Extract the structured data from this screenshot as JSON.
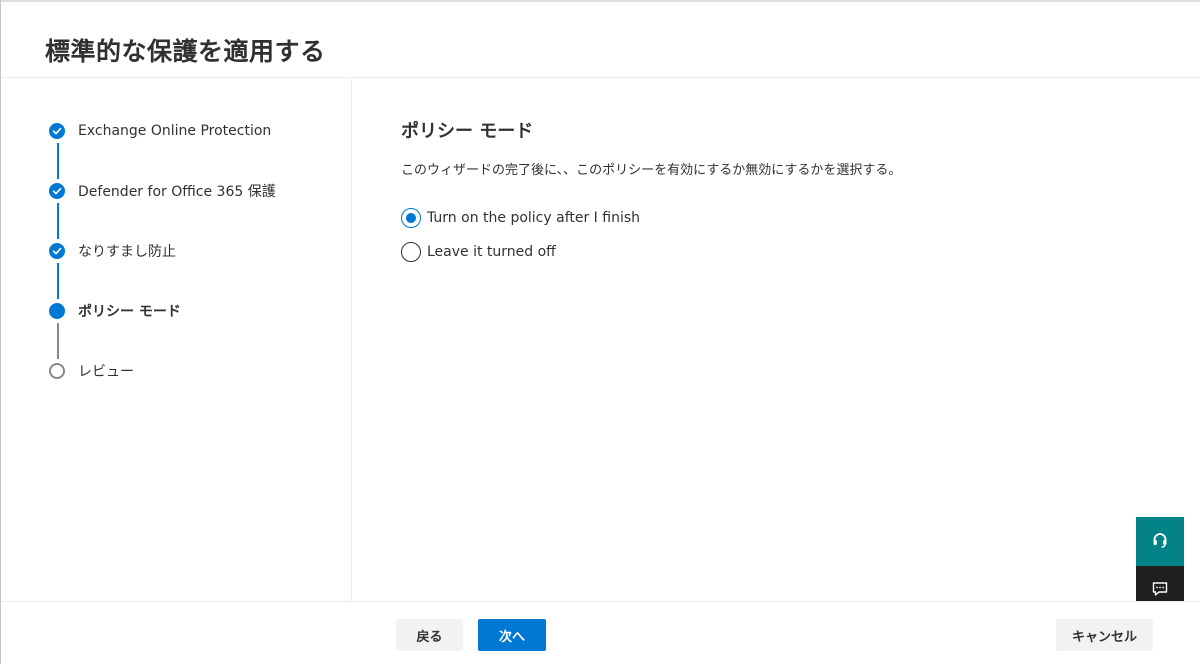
{
  "header": {
    "title": "標準的な保護を適用する"
  },
  "steps": [
    {
      "label": "Exchange Online Protection",
      "state": "done"
    },
    {
      "label": "Defender for Office 365 保護",
      "state": "done"
    },
    {
      "label": "なりすまし防止",
      "state": "done"
    },
    {
      "label": "ポリシー モード",
      "state": "current"
    },
    {
      "label": "レビュー",
      "state": "todo"
    }
  ],
  "content": {
    "section_title": "ポリシー モード",
    "description": "このウィザードの完了後に、、このポリシーを有効にするか無効にするかを選択する。",
    "options": [
      {
        "label": "Turn on the policy after I finish",
        "checked": true
      },
      {
        "label": "Leave it turned off",
        "checked": false
      }
    ]
  },
  "footer": {
    "back_label": "戻る",
    "next_label": "次へ",
    "cancel_label": "キャンセル"
  },
  "side_widgets": {
    "support_icon": "headset-icon",
    "feedback_icon": "feedback-icon"
  },
  "colors": {
    "accent": "#0078d4",
    "support_widget": "#038387",
    "feedback_widget": "#201f1e"
  }
}
